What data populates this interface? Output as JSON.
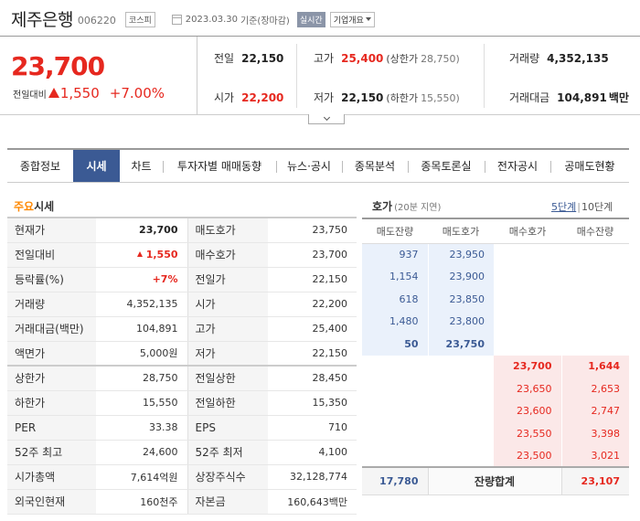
{
  "header": {
    "name": "제주은행",
    "code": "006220",
    "market": "코스피",
    "date": "2023.03.30",
    "date_status": "기준(장마감)",
    "realtime_label": "실시간",
    "overview_label": "기업개요"
  },
  "summary": {
    "price": "23,700",
    "change_label": "전일대비",
    "change": "1,550",
    "change_rate": "+7.00%",
    "prev_label": "전일",
    "prev": "22,150",
    "high_label": "고가",
    "high": "25,400",
    "upper_label": "(상한가",
    "upper": "28,750)",
    "volume_label": "거래량",
    "volume": "4,352,135",
    "open_label": "시가",
    "open": "22,200",
    "low_label": "저가",
    "low": "22,150",
    "lower_label": "(하한가",
    "lower": "15,550)",
    "value_label": "거래대금",
    "value": "104,891",
    "value_unit": "백만"
  },
  "tabs": [
    {
      "label": "종합정보"
    },
    {
      "label": "시세"
    },
    {
      "label": "차트"
    },
    {
      "label": "투자자별 매매동향"
    },
    {
      "label": "뉴스·공시"
    },
    {
      "label": "종목분석"
    },
    {
      "label": "종목토론실"
    },
    {
      "label": "전자공시"
    },
    {
      "label": "공매도현황"
    }
  ],
  "main_quote": {
    "title_accent": "주요",
    "title_rest": "시세",
    "rows": [
      {
        "l1": "현재가",
        "v1": "23,700",
        "l2": "매도호가",
        "v2": "23,750"
      },
      {
        "l1": "전일대비",
        "v1": "1,550",
        "l2": "매수호가",
        "v2": "23,700"
      },
      {
        "l1": "등락률(%)",
        "v1": "+7%",
        "l2": "전일가",
        "v2": "22,150"
      },
      {
        "l1": "거래량",
        "v1": "4,352,135",
        "l2": "시가",
        "v2": "22,200"
      },
      {
        "l1": "거래대금(백만)",
        "v1": "104,891",
        "l2": "고가",
        "v2": "25,400"
      },
      {
        "l1": "액면가",
        "v1": "5,000원",
        "l2": "저가",
        "v2": "22,150"
      },
      {
        "l1": "상한가",
        "v1": "28,750",
        "l2": "전일상한",
        "v2": "28,450"
      },
      {
        "l1": "하한가",
        "v1": "15,550",
        "l2": "전일하한",
        "v2": "15,350"
      },
      {
        "l1": "PER",
        "v1": "33.38",
        "l2": "EPS",
        "v2": "710"
      },
      {
        "l1": "52주 최고",
        "v1": "24,600",
        "l2": "52주 최저",
        "v2": "4,100"
      },
      {
        "l1": "시가총액",
        "v1": "7,614억원",
        "l2": "상장주식수",
        "v2": "32,128,774"
      },
      {
        "l1": "외국인현재",
        "v1": "160천주",
        "l2": "자본금",
        "v2": "160,643백만"
      }
    ]
  },
  "orderbook": {
    "title": "호가",
    "delay": "(20분 지연)",
    "opt_on": "5단계",
    "opt_sep": "|",
    "opt_off": "10단계",
    "headers": [
      "매도잔량",
      "매도호가",
      "매수호가",
      "매수잔량"
    ],
    "asks": [
      {
        "qty": "937",
        "price": "23,950"
      },
      {
        "qty": "1,154",
        "price": "23,900"
      },
      {
        "qty": "618",
        "price": "23,850"
      },
      {
        "qty": "1,480",
        "price": "23,800"
      },
      {
        "qty": "50",
        "price": "23,750"
      }
    ],
    "bids": [
      {
        "price": "23,700",
        "qty": "1,644"
      },
      {
        "price": "23,650",
        "qty": "2,653"
      },
      {
        "price": "23,600",
        "qty": "2,747"
      },
      {
        "price": "23,550",
        "qty": "3,398"
      },
      {
        "price": "23,500",
        "qty": "3,021"
      }
    ],
    "total_ask": "17,780",
    "total_label": "잔량합계",
    "total_bid": "23,107"
  },
  "colors": {
    "up": "#e6281f",
    "tab_active": "#3b5a94",
    "accent": "#ff8800",
    "ask_bg": "#eaf1fb",
    "bid_bg": "#fbe8e8"
  }
}
